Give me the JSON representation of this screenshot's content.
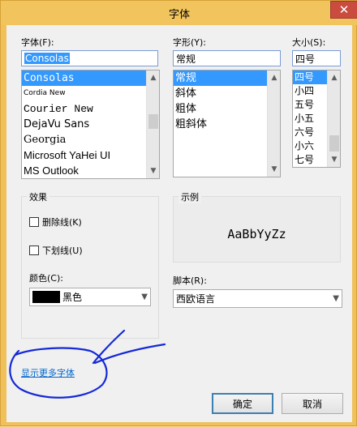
{
  "window": {
    "title": "字体",
    "close_glyph": "✕"
  },
  "font": {
    "label": "字体(F):",
    "value": "Consolas",
    "items": [
      "Consolas",
      "Cordia New",
      "Courier New",
      "DejaVu Sans",
      "Georgia",
      "Microsoft YaHei UI",
      "MS Outlook"
    ],
    "selected": "Consolas"
  },
  "style": {
    "label": "字形(Y):",
    "value": "常规",
    "items": [
      "常规",
      "斜体",
      "粗体",
      "粗斜体"
    ],
    "selected": "常规"
  },
  "size": {
    "label": "大小(S):",
    "value": "四号",
    "items": [
      "四号",
      "小四",
      "五号",
      "小五",
      "六号",
      "小六",
      "七号"
    ],
    "selected": "四号"
  },
  "effects": {
    "title": "效果",
    "strikeout_label": "删除线(K)",
    "underline_label": "下划线(U)",
    "color_label": "颜色(C):",
    "color_value": "黑色",
    "color_hex": "#000000"
  },
  "sample": {
    "title": "示例",
    "text": "AaBbYyZz"
  },
  "script": {
    "label": "脚本(R):",
    "value": "西欧语言"
  },
  "more_fonts_link": "显示更多字体",
  "buttons": {
    "ok": "确定",
    "cancel": "取消"
  },
  "colors": {
    "title_bar": "#f2c45d",
    "selection": "#3399ff",
    "close": "#c94c3f",
    "link": "#0066cc",
    "annotation_ink": "#1428d8"
  }
}
